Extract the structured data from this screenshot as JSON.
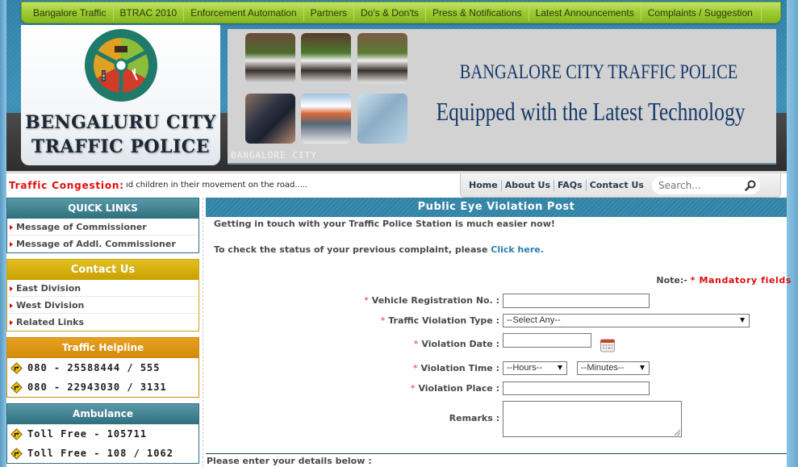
{
  "topnav": {
    "items": [
      {
        "label": "Bangalore Traffic"
      },
      {
        "label": "BTRAC 2010"
      },
      {
        "label": "Enforcement Automation"
      },
      {
        "label": "Partners"
      },
      {
        "label": "Do's & Don'ts"
      },
      {
        "label": "Press & Notifications"
      },
      {
        "label": "Latest Announcements"
      },
      {
        "label": "Complaints / Suggestion"
      }
    ]
  },
  "logo": {
    "line1": "BENGALURU CITY",
    "line2": "TRAFFIC POLICE",
    "emblem_icon": "traffic-police-emblem-icon"
  },
  "banner": {
    "heading": "BANGALORE CITY TRAFFIC POLICE",
    "subheading": "Equipped with the Latest Technology",
    "caption": "BANGALORE CITY"
  },
  "ticker": {
    "label": "Traffic Congestion:",
    "text": "ıd children in their movement on the road....."
  },
  "utility_nav": {
    "items": [
      {
        "label": "Home"
      },
      {
        "label": "About Us"
      },
      {
        "label": "FAQs"
      },
      {
        "label": "Contact Us"
      }
    ],
    "search_placeholder": "Search..."
  },
  "sidebar": {
    "quick_links": {
      "title": "QUICK LINKS",
      "items": [
        {
          "label": "Message of Commissioner"
        },
        {
          "label": "Message of Addl. Commissioner"
        }
      ]
    },
    "contact_us": {
      "title": "Contact Us",
      "items": [
        {
          "label": "East Division"
        },
        {
          "label": "West Division"
        },
        {
          "label": "Related Links"
        }
      ]
    },
    "traffic_helpline": {
      "title": "Traffic Helpline",
      "items": [
        {
          "label": "080 - 25588444 / 555"
        },
        {
          "label": "080 - 22943030 / 3131"
        }
      ]
    },
    "ambulance": {
      "title": "Ambulance",
      "items": [
        {
          "label": "Toll Free - 105711"
        },
        {
          "label": "Toll Free - 108 / 1062"
        }
      ]
    }
  },
  "main": {
    "title": "Public Eye Violation Post",
    "intro": "Getting in touch with your Traffic Police Station is much easier now!",
    "status_prefix": "To check the status of your previous complaint, please ",
    "status_link": "Click here.",
    "note_prefix": "Note:- ",
    "note_star": "*",
    "note_text": " Mandatory fields",
    "form": {
      "star": "*",
      "vehicle_reg_label": "Vehicle Registration No. :",
      "vehicle_reg_value": "",
      "violation_type_label": "Traffic Violation Type :",
      "violation_type_selected": "--Select Any--",
      "violation_date_label": "Violation Date :",
      "violation_date_value": "",
      "violation_time_label": "Violation Time :",
      "hours_selected": "--Hours--",
      "minutes_selected": "--Minutes--",
      "violation_place_label": "Violation Place :",
      "violation_place_value": "",
      "remarks_label": "Remarks :",
      "remarks_value": ""
    },
    "details_label": "Please enter your details below :"
  },
  "colors": {
    "nav_green": "#9fcc34",
    "header_blue": "#2f7fa8",
    "section_teal": "#2e6f7e",
    "contact_gold": "#c9a000",
    "helpline_orange": "#d08a0c",
    "alert_red": "#e00d0d",
    "link_blue": "#2a7fb0"
  }
}
